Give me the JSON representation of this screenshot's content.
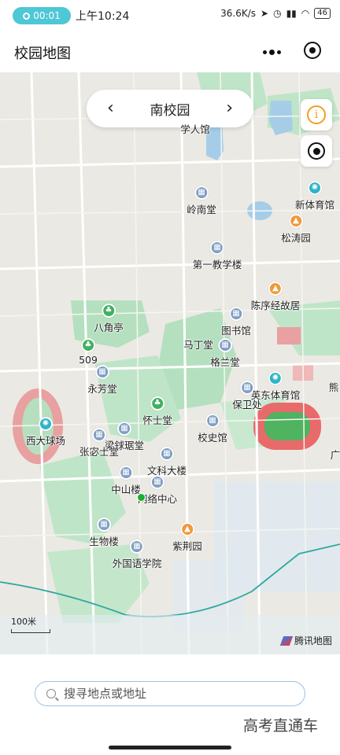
{
  "status": {
    "pill_time": "00:01",
    "time": "上午10:24",
    "network": "36.6K/s",
    "battery": "46"
  },
  "nav": {
    "title": "校园地图"
  },
  "campus": {
    "name": "南校园",
    "prev": "‹",
    "next": "›"
  },
  "side": {
    "info_glyph": "i"
  },
  "pois": [
    {
      "name": "学人馆",
      "pin": "none"
    },
    {
      "name": "岭南堂",
      "pin": "blue"
    },
    {
      "name": "新体育馆",
      "pin": "teal"
    },
    {
      "name": "松涛园",
      "pin": "orange"
    },
    {
      "name": "第一教学楼",
      "pin": "blue"
    },
    {
      "name": "陈序经故居",
      "pin": "orange"
    },
    {
      "name": "图书馆",
      "pin": "blue"
    },
    {
      "name": "八角亭",
      "pin": "green"
    },
    {
      "name": "509",
      "pin": "green"
    },
    {
      "name": "马丁堂",
      "pin": "blue"
    },
    {
      "name": "格兰堂",
      "pin": "blue"
    },
    {
      "name": "永芳堂",
      "pin": "blue"
    },
    {
      "name": "英东体育馆",
      "pin": "teal"
    },
    {
      "name": "保卫处",
      "pin": "blue"
    },
    {
      "name": "熊",
      "pin": "none"
    },
    {
      "name": "怀士堂",
      "pin": "green"
    },
    {
      "name": "西大球场",
      "pin": "teal"
    },
    {
      "name": "梁銶琚堂",
      "pin": "blue"
    },
    {
      "name": "张宓士堂",
      "pin": "blue"
    },
    {
      "name": "校史馆",
      "pin": "blue"
    },
    {
      "name": "广",
      "pin": "none"
    },
    {
      "name": "文科大楼",
      "pin": "blue"
    },
    {
      "name": "中山楼",
      "pin": "blue"
    },
    {
      "name": "网络中心",
      "pin": "blue"
    },
    {
      "name": "生物楼",
      "pin": "blue"
    },
    {
      "name": "紫荆园",
      "pin": "orange"
    },
    {
      "name": "外国语学院",
      "pin": "blue"
    }
  ],
  "map": {
    "scale": "100米",
    "provider": "腾讯地图"
  },
  "search": {
    "placeholder": "搜寻地点或地址"
  },
  "watermark": "高考直通车"
}
